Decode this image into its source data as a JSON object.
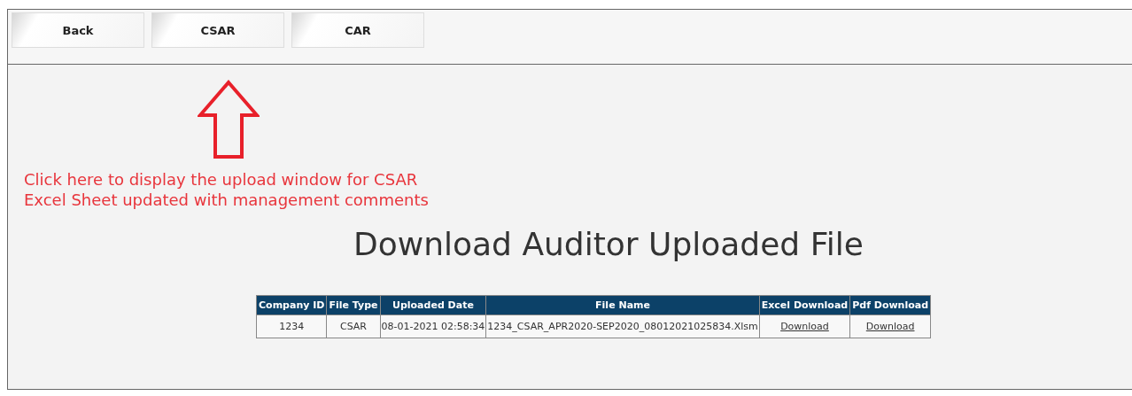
{
  "toolbar": {
    "buttons": [
      {
        "label": "Back"
      },
      {
        "label": "CSAR"
      },
      {
        "label": "CAR"
      }
    ]
  },
  "annotation": {
    "lines": [
      "Click here to display the upload window for CSAR",
      "Excel Sheet updated with management comments"
    ]
  },
  "title": "Download Auditor Uploaded File",
  "table": {
    "columns": [
      "Company ID",
      "File Type",
      "Uploaded Date",
      "File Name",
      "Excel Download",
      "Pdf Download"
    ],
    "rows": [
      {
        "cells": [
          "1234",
          "CSAR",
          "08-01-2021 02:58:34",
          "1234_CSAR_APR2020-SEP2020_08012021025834.Xlsm"
        ],
        "links": [
          "Download",
          "Download"
        ]
      }
    ]
  }
}
